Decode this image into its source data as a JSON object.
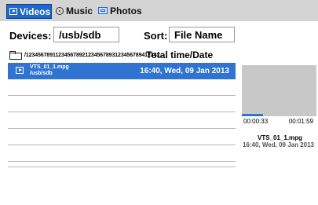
{
  "tabs": {
    "videos": "Videos",
    "music": "Music",
    "photos": "Photos"
  },
  "devices": {
    "label": "Devices:",
    "value": "/usb/sdb"
  },
  "sort": {
    "label": "Sort:",
    "value": "File Name"
  },
  "folder": {
    "path": "/12345678911234567892123456789312345678941234...",
    "total_header": "Total time/Date"
  },
  "selected_file": {
    "name": "VTS_01_1.mpg",
    "path": "/usb/sdb",
    "datetime": "16:40, Wed, 09 Jan 2013"
  },
  "preview": {
    "elapsed": "00:00:33",
    "total": "00:01:59",
    "progress": 0.28,
    "file_name": "VTS_01_1.mpg",
    "file_date": "16:40, Wed, 09 Jan 2013"
  },
  "colors": {
    "accent": "#2f74d0",
    "tabbar": "#d4d4d4",
    "preview_bg": "#c8c8c8"
  },
  "icons": {
    "videos_tab": "play-icon",
    "music_tab": "disc-icon",
    "photos_tab": "photo-icon",
    "folder": "folder-icon",
    "file": "video-file-icon"
  }
}
